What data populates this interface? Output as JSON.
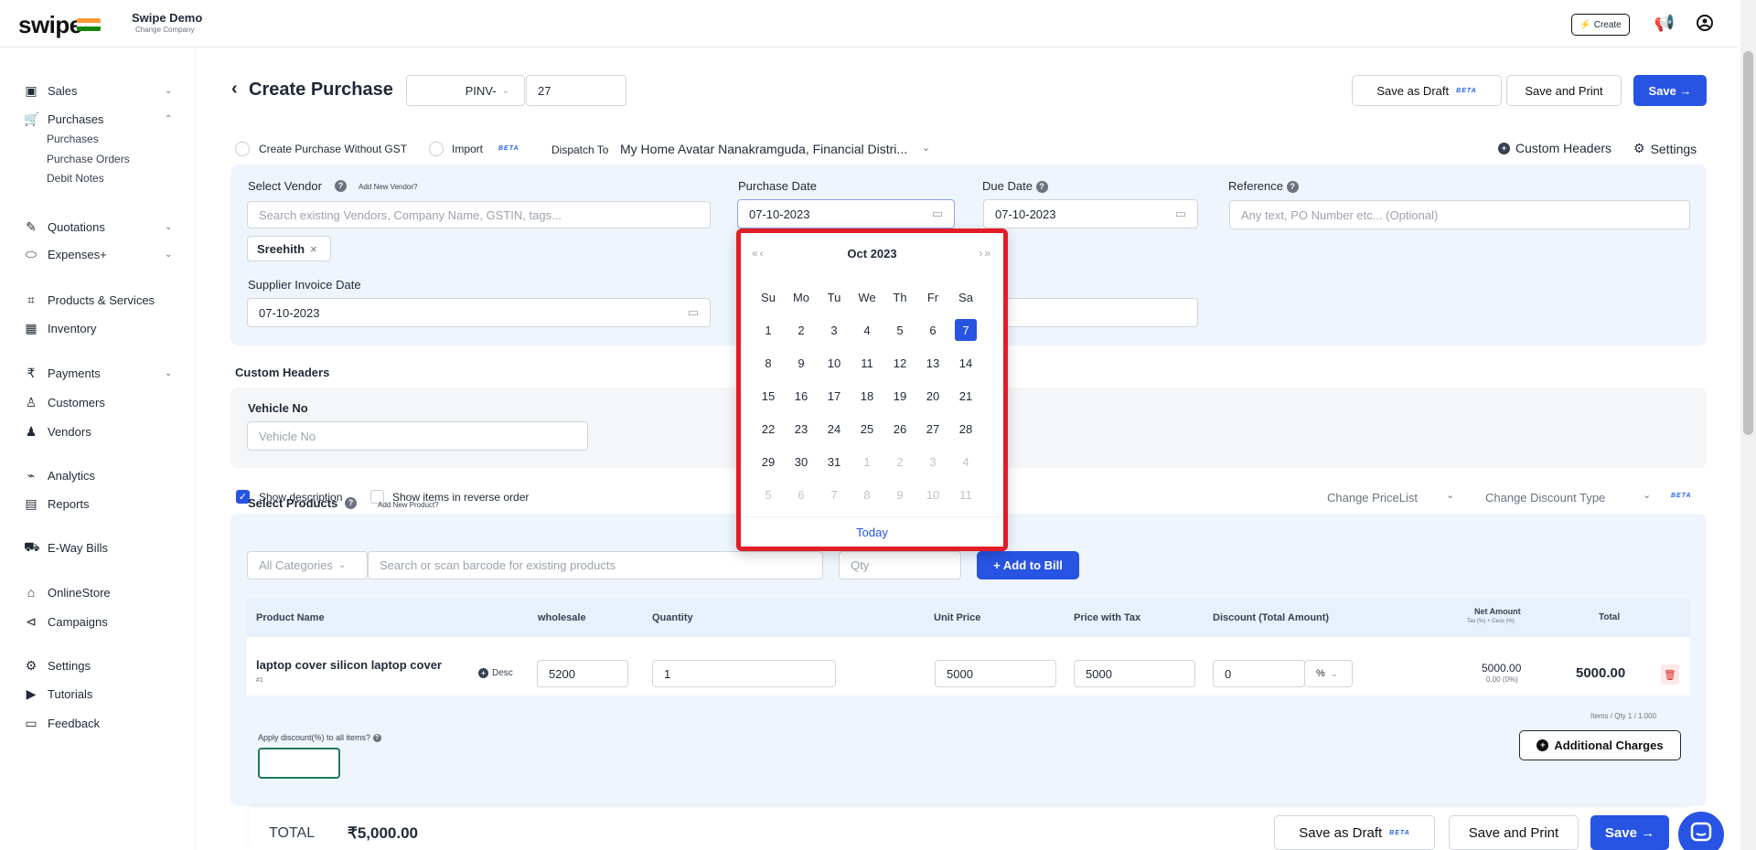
{
  "topbar": {
    "brand": "swipe",
    "company_name": "Swipe Demo",
    "change_company": "Change Company",
    "create_label": "Create",
    "icons": [
      "megaphone-icon",
      "account-icon"
    ]
  },
  "sidebar": {
    "items": [
      {
        "label": "Sales",
        "icon": "sales-icon",
        "chevron": "⌄"
      },
      {
        "label": "Purchases",
        "icon": "cart-icon",
        "chevron": "⌃"
      },
      {
        "label": "Quotations",
        "icon": "pen-icon",
        "chevron": "⌄"
      },
      {
        "label": "Expenses+",
        "icon": "tag-icon",
        "chevron": "⌄"
      },
      {
        "label": "Products & Services",
        "icon": "box-icon"
      },
      {
        "label": "Inventory",
        "icon": "warehouse-icon"
      },
      {
        "label": "Payments",
        "icon": "rupee-icon",
        "chevron": "⌄"
      },
      {
        "label": "Customers",
        "icon": "user-icon"
      },
      {
        "label": "Vendors",
        "icon": "users-icon"
      },
      {
        "label": "Analytics",
        "icon": "chart-icon"
      },
      {
        "label": "Reports",
        "icon": "report-icon"
      },
      {
        "label": "E-Way Bills",
        "icon": "truck-icon"
      },
      {
        "label": "OnlineStore",
        "icon": "store-icon"
      },
      {
        "label": "Campaigns",
        "icon": "campaign-icon"
      },
      {
        "label": "Settings",
        "icon": "gear-icon"
      },
      {
        "label": "Tutorials",
        "icon": "youtube-icon"
      },
      {
        "label": "Feedback",
        "icon": "feedback-icon"
      }
    ],
    "sub_items": [
      "Purchases",
      "Purchase Orders",
      "Debit Notes"
    ]
  },
  "header": {
    "title": "Create Purchase",
    "prefix": "PINV-",
    "number": "27",
    "save_draft": "Save as Draft",
    "beta": "BETA",
    "save_print": "Save and Print",
    "save": "Save →"
  },
  "options": {
    "without_gst": "Create Purchase Without GST",
    "import": "Import",
    "dispatch_label": "Dispatch To",
    "dispatch_value": "My Home Avatar Nanakramguda, Financial Distri...",
    "custom_headers": "Custom Headers",
    "settings": "Settings"
  },
  "form": {
    "vendor_label": "Select Vendor",
    "add_vendor": "Add New Vendor?",
    "vendor_placeholder": "Search existing Vendors, Company Name, GSTIN, tags...",
    "vendor_chip": "Sreehith",
    "purchase_date_label": "Purchase Date",
    "purchase_date": "07-10-2023",
    "due_date_label": "Due Date",
    "due_date": "07-10-2023",
    "reference_label": "Reference",
    "reference_placeholder": "Any text, PO Number etc... (Optional)",
    "supplier_date_label": "Supplier Invoice Date",
    "supplier_date": "07-10-2023"
  },
  "calendar": {
    "month": "Oct",
    "year": "2023",
    "weekdays": [
      "Su",
      "Mo",
      "Tu",
      "We",
      "Th",
      "Fr",
      "Sa"
    ],
    "days": [
      [
        "1",
        "2",
        "3",
        "4",
        "5",
        "6",
        "7"
      ],
      [
        "8",
        "9",
        "10",
        "11",
        "12",
        "13",
        "14"
      ],
      [
        "15",
        "16",
        "17",
        "18",
        "19",
        "20",
        "21"
      ],
      [
        "22",
        "23",
        "24",
        "25",
        "26",
        "27",
        "28"
      ],
      [
        "29",
        "30",
        "31",
        "1",
        "2",
        "3",
        "4"
      ],
      [
        "5",
        "6",
        "7",
        "8",
        "9",
        "10",
        "11"
      ]
    ],
    "selected": "7",
    "today": "Today"
  },
  "custom_headers": {
    "title": "Custom Headers",
    "vehicle_label": "Vehicle No",
    "vehicle_placeholder": "Vehicle No"
  },
  "items_options": {
    "show_description": "Show description",
    "reverse_order": "Show items in reverse order",
    "change_pricelist": "Change PriceList",
    "change_discount": "Change Discount Type",
    "beta": "BETA"
  },
  "products": {
    "label": "Select Products",
    "add_product": "Add New Product?",
    "categories": "All Categories",
    "search_placeholder": "Search or scan barcode for existing products",
    "qty_placeholder": "Qty",
    "add_to_bill": "+ Add to Bill",
    "columns": [
      "Product Name",
      "wholesale",
      "Quantity",
      "Unit Price",
      "Price with Tax",
      "Discount (Total Amount)",
      "Net Amount",
      "Total"
    ],
    "net_sub": "Tax (%) + Cess (%)",
    "row": {
      "name": "laptop cover silicon laptop cover",
      "index": "#1",
      "desc": "Desc",
      "wholesale": "5200",
      "quantity": "1",
      "unit_price": "5000",
      "price_with_tax": "5000",
      "discount": "0",
      "discount_type": "%",
      "net_amount": "5000.00",
      "net_tax": "0.00 (0%)",
      "total": "5000.00"
    },
    "items_qty": "Items / Qty 1 / 1.000",
    "apply_discount": "Apply discount(%) to all items?",
    "additional_charges": "Additional Charges"
  },
  "footer": {
    "total_label": "TOTAL",
    "total_value": "₹5,000.00",
    "save_draft": "Save as Draft",
    "beta": "BETA",
    "save_print": "Save and Print",
    "save": "Save →"
  },
  "colors": {
    "primary": "#2754e3",
    "highlight": "#e11d25",
    "panel": "#eef5fd"
  }
}
